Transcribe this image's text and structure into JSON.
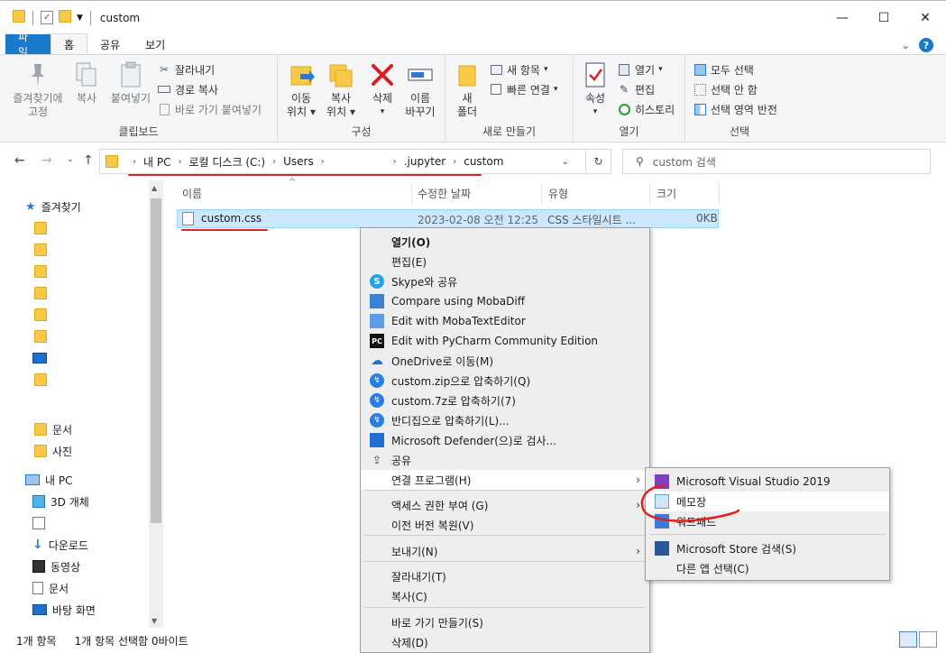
{
  "window": {
    "title": "custom"
  },
  "ribbon_tabs": [
    "파일",
    "홈",
    "공유",
    "보기"
  ],
  "clipboard": {
    "pin_line1": "즐겨찾기에",
    "pin_line2": "고정",
    "copy": "복사",
    "paste": "붙여넣기",
    "cut": "잘라내기",
    "copy_path": "경로 복사",
    "paste_shortcut": "바로 가기 붙여넣기",
    "label": "클립보드"
  },
  "organize": {
    "move_line1": "이동",
    "move_line2": "위치",
    "copyto_line1": "복사",
    "copyto_line2": "위치",
    "delete": "삭제",
    "rename_line1": "이름",
    "rename_line2": "바꾸기",
    "label": "구성"
  },
  "new": {
    "new_folder_line1": "새",
    "new_folder_line2": "폴더",
    "new_item": "새 항목",
    "easy_access": "빠른 연결",
    "label": "새로 만들기"
  },
  "open": {
    "properties": "속성",
    "open": "열기",
    "edit": "편집",
    "history": "히스토리",
    "label": "열기"
  },
  "select": {
    "select_all": "모두 선택",
    "select_none": "선택 안 함",
    "invert": "선택 영역 반전",
    "label": "선택"
  },
  "address": {
    "segments": [
      "내 PC",
      "로컬 디스크 (C:)",
      "Users",
      ".jupyter",
      "custom"
    ]
  },
  "search": {
    "placeholder": "custom 검색"
  },
  "nav": {
    "quick_access": "즐겨찾기",
    "documents": "문서",
    "pictures": "사진",
    "this_pc": "내 PC",
    "objects_3d": "3D 개체",
    "downloads": "다운로드",
    "videos": "동영상",
    "documents2": "문서",
    "desktop": "바탕 화면"
  },
  "columns": {
    "name": "이름",
    "modified": "수정한 날짜",
    "type": "유형",
    "size": "크기"
  },
  "file": {
    "name": "custom.css",
    "modified": "2023-02-08 오전 12:25",
    "type": "CSS 스타일시트 ...",
    "size": "0KB"
  },
  "context_menu": [
    {
      "label": "열기(O)",
      "bold": true
    },
    {
      "label": "편집(E)"
    },
    {
      "label": "Skype와 공유",
      "icon": "skype-icon"
    },
    {
      "label": "Compare using MobaDiff",
      "icon": "mobadiff-icon"
    },
    {
      "label": "Edit with MobaTextEditor",
      "icon": "mobatexteditor-icon"
    },
    {
      "label": "Edit with PyCharm Community Edition",
      "icon": "pycharm-icon"
    },
    {
      "label": "OneDrive로 이동(M)",
      "icon": "onedrive-icon"
    },
    {
      "label": "custom.zip으로 압축하기(Q)",
      "icon": "bandizip-icon"
    },
    {
      "label": "custom.7z로 압축하기(7)",
      "icon": "bandizip-icon"
    },
    {
      "label": "반디집으로 압축하기(L)...",
      "icon": "bandizip-icon"
    },
    {
      "label": "Microsoft Defender(으)로 검사...",
      "icon": "defender-icon"
    },
    {
      "label": "공유",
      "icon": "share-icon"
    },
    {
      "label": "연결 프로그램(H)",
      "submenu": true
    },
    {
      "label": "액세스 권한 부여 (G)",
      "submenu": true
    },
    {
      "label": "이전 버전 복원(V)"
    },
    {
      "label": "보내기(N)",
      "submenu": true
    },
    {
      "label": "잘라내기(T)"
    },
    {
      "label": "복사(C)"
    },
    {
      "label": "바로 가기 만들기(S)"
    },
    {
      "label": "삭제(D)"
    }
  ],
  "open_with": [
    {
      "label": "Microsoft Visual Studio 2019",
      "icon": "visual-studio-icon"
    },
    {
      "label": "메모장",
      "icon": "notepad-icon"
    },
    {
      "label": "워드패드",
      "icon": "wordpad-icon"
    },
    {
      "label": "Microsoft Store 검색(S)",
      "icon": "store-icon"
    },
    {
      "label": "다른 앱 선택(C)"
    }
  ],
  "status": {
    "count": "1개 항목",
    "selected": "1개 항목 선택함 0바이트"
  },
  "colors": {
    "accent": "#1979ca",
    "selection": "#cce8ff",
    "folder": "#f7c948",
    "annotation": "#e32020"
  }
}
